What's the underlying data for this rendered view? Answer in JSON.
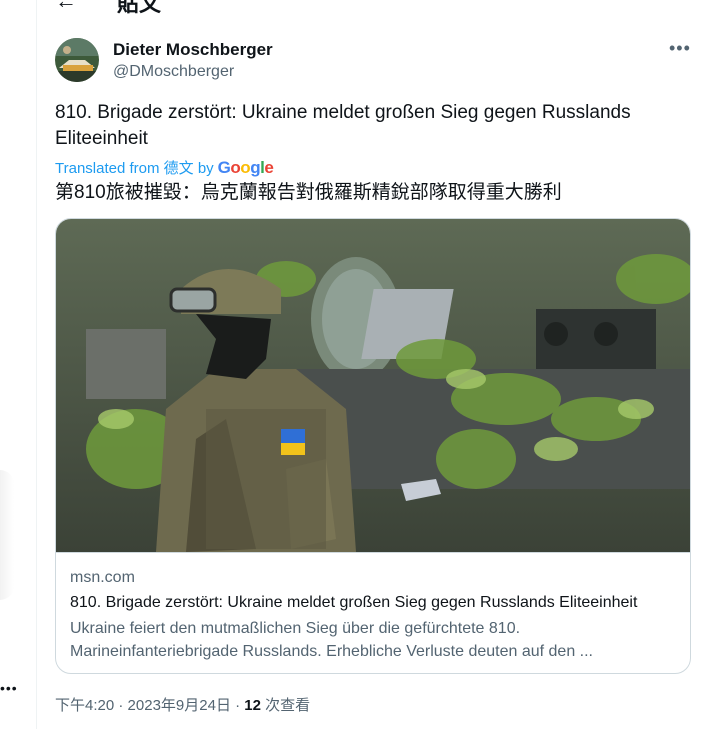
{
  "header": {
    "title": "貼文"
  },
  "author": {
    "name": "Dieter Moschberger",
    "handle": "@DMoschberger"
  },
  "tweet": {
    "text": "810. Brigade zerstört: Ukraine meldet großen Sieg gegen Russlands Eliteeinheit",
    "translated_label": "Translated from 德文 by",
    "translated_provider": "Google",
    "translation": "第810旅被摧毀：烏克蘭報告對俄羅斯精銳部隊取得重大勝利"
  },
  "card": {
    "domain": "msn.com",
    "title": "810. Brigade zerstört: Ukraine meldet großen Sieg gegen Russlands Eliteeinheit",
    "description": "Ukraine feiert den mutmaßlichen Sieg über die gefürchtete 810. Marineinfanteriebrigade Russlands. Erhebliche Verluste deuten auf den ..."
  },
  "meta": {
    "time": "下午4:20",
    "sep1": " · ",
    "date": "2023年9月24日",
    "sep2": " · ",
    "views_count": "12",
    "views_label": " 次查看"
  },
  "icons": {
    "back": "back-arrow-icon",
    "more": "more-dots-icon"
  }
}
